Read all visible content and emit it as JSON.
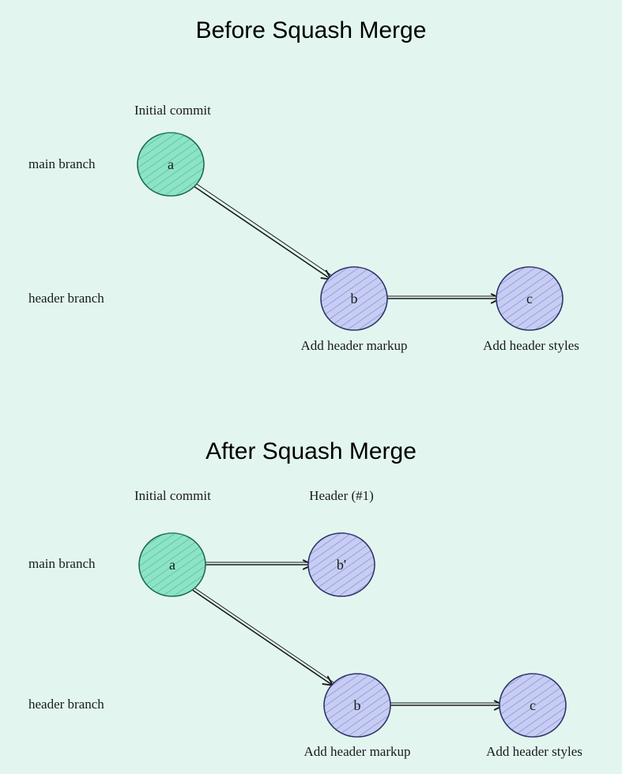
{
  "colors": {
    "bg": "#e2f6ef",
    "green_fill": "#8de3c6",
    "green_stroke": "#2a7d60",
    "blue_fill": "#aeb5e8",
    "blue_stroke": "#3a3f7a",
    "arrow": "#1a1a1a"
  },
  "before": {
    "title": "Before Squash Merge",
    "main_branch_label": "main branch",
    "header_branch_label": "header branch",
    "commit_a": {
      "id": "a",
      "label": "Initial commit"
    },
    "commit_b": {
      "id": "b",
      "label": "Add header markup"
    },
    "commit_c": {
      "id": "c",
      "label": "Add header styles"
    }
  },
  "after": {
    "title": "After Squash Merge",
    "main_branch_label": "main branch",
    "header_branch_label": "header branch",
    "commit_a": {
      "id": "a",
      "label": "Initial commit"
    },
    "commit_bprime": {
      "id": "b'",
      "label": "Header (#1)"
    },
    "commit_b": {
      "id": "b",
      "label": "Add header markup"
    },
    "commit_c": {
      "id": "c",
      "label": "Add header styles"
    }
  }
}
